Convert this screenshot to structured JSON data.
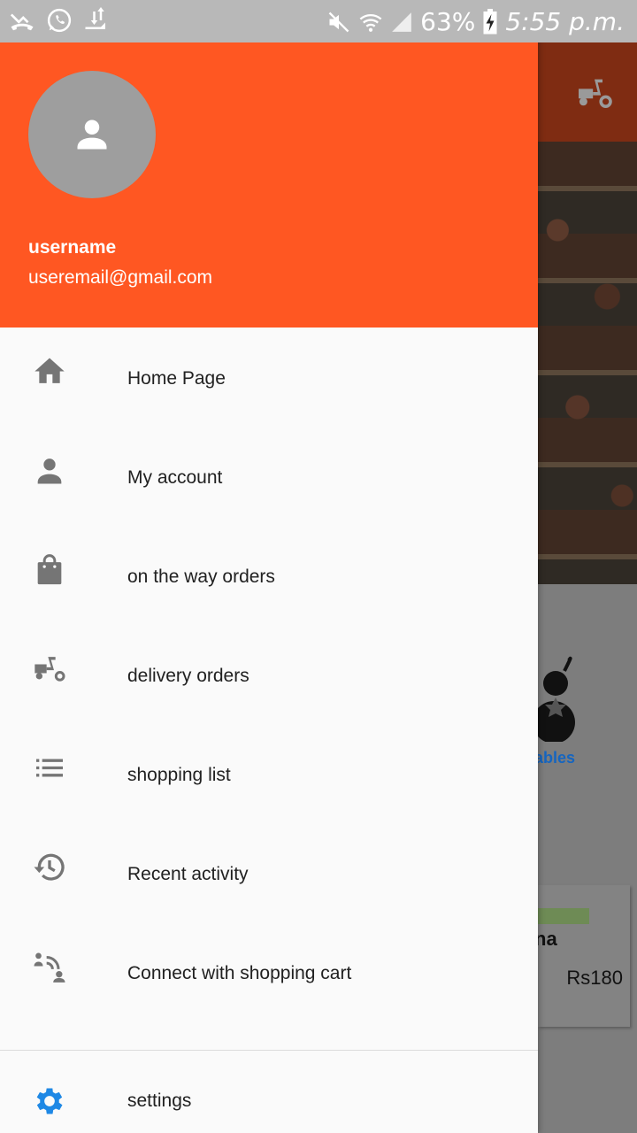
{
  "status_bar": {
    "battery": "63%",
    "time": "5:55 p.m."
  },
  "drawer": {
    "header": {
      "username": "username",
      "email": "useremail@gmail.com"
    },
    "menu": [
      {
        "label": "Home Page",
        "icon": "home-icon"
      },
      {
        "label": "My account",
        "icon": "person-icon"
      },
      {
        "label": "on the way orders",
        "icon": "shopping-bag-icon"
      },
      {
        "label": "delivery orders",
        "icon": "delivery-scooter-icon"
      },
      {
        "label": "shopping list",
        "icon": "list-icon"
      },
      {
        "label": "Recent activity",
        "icon": "history-icon"
      },
      {
        "label": "Connect with shopping cart",
        "icon": "connect-cart-icon"
      }
    ],
    "settings": {
      "label": "settings",
      "icon": "gear-icon"
    }
  },
  "background": {
    "category_label": "ables",
    "card_title": "na",
    "card_price": "Rs180"
  },
  "colors": {
    "header": "#ff5722",
    "icon_grey": "#757575",
    "settings_icon": "#1e88e5"
  }
}
